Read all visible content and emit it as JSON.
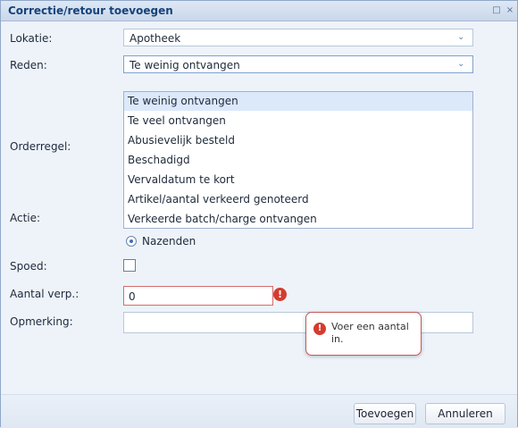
{
  "dialog": {
    "title": "Correctie/retour toevoegen",
    "icons": [
      "restore-icon",
      "close-icon"
    ]
  },
  "form": {
    "lokatie_label": "Lokatie:",
    "lokatie_value": "Apotheek",
    "reden_label": "Reden:",
    "reden_value": "Te weinig ontvangen",
    "orderregel_label": "Orderregel:",
    "actie_label": "Actie:",
    "actie_option": "Nazenden",
    "spoed_label": "Spoed:",
    "aantal_label": "Aantal verp.:",
    "aantal_value": "0",
    "opmerking_label": "Opmerking:"
  },
  "dropdown": {
    "options": [
      "Te weinig ontvangen",
      "Te veel ontvangen",
      "Abusievelijk besteld",
      "Beschadigd",
      "Vervaldatum te kort",
      "Artikel/aantal verkeerd genoteerd",
      "Verkeerde batch/charge ontvangen"
    ],
    "selected_index": 0
  },
  "validation": {
    "tooltip": "Voer een aantal in."
  },
  "footer": {
    "add_button": "Toevoegen",
    "cancel_button": "Annuleren"
  },
  "colors": {
    "accent": "#16437a",
    "error": "#d63b2f",
    "selection": "#dce9fb"
  }
}
